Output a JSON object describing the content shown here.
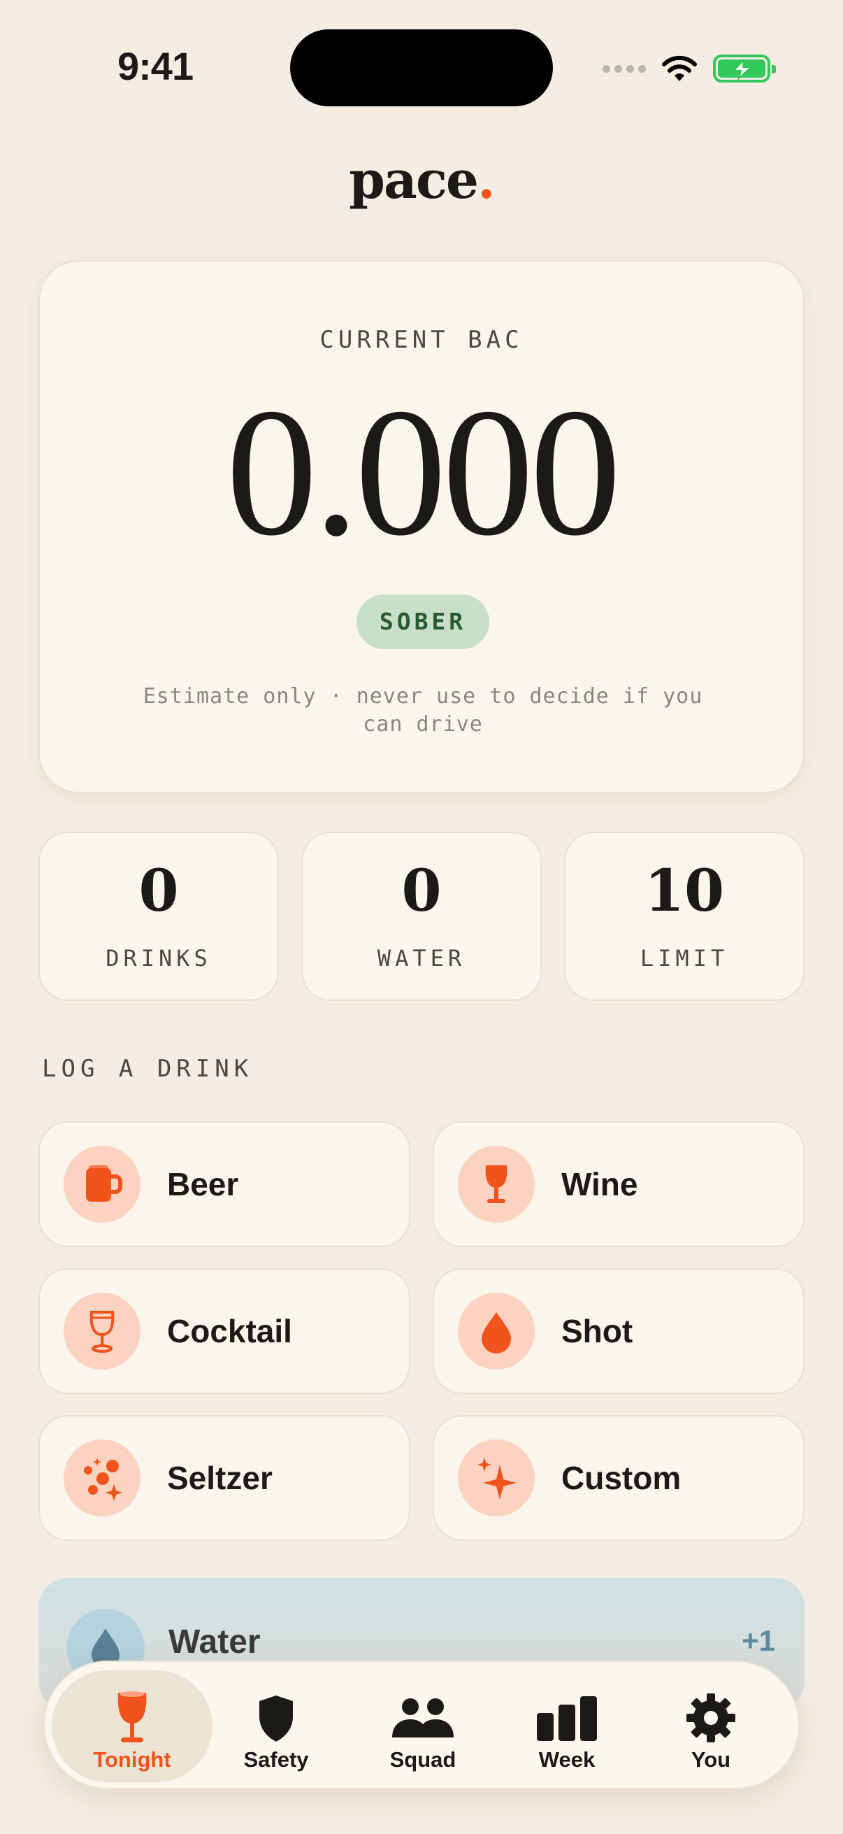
{
  "status_bar": {
    "time": "9:41"
  },
  "app": {
    "logo_text": "pace",
    "logo_dot": "."
  },
  "bac_card": {
    "label": "CURRENT BAC",
    "value": "0.000",
    "status_badge": "SOBER",
    "disclaimer": "Estimate only · never use to decide if you can drive"
  },
  "stats": [
    {
      "value": "0",
      "label": "DRINKS"
    },
    {
      "value": "0",
      "label": "WATER"
    },
    {
      "value": "10",
      "label": "LIMIT"
    }
  ],
  "log_section": {
    "title": "LOG A DRINK",
    "drinks": [
      {
        "label": "Beer",
        "icon": "mug-icon"
      },
      {
        "label": "Wine",
        "icon": "wine-glass-icon"
      },
      {
        "label": "Cocktail",
        "icon": "cocktail-glass-icon"
      },
      {
        "label": "Shot",
        "icon": "drop-icon"
      },
      {
        "label": "Seltzer",
        "icon": "bubbles-icon"
      },
      {
        "label": "Custom",
        "icon": "sparkle-icon"
      }
    ]
  },
  "water_button": {
    "label": "Water",
    "action": "+1",
    "icon": "water-drop-icon"
  },
  "tab_bar": {
    "tabs": [
      {
        "label": "Tonight",
        "icon": "glass-icon",
        "active": true
      },
      {
        "label": "Safety",
        "icon": "shield-icon",
        "active": false
      },
      {
        "label": "Squad",
        "icon": "people-icon",
        "active": false
      },
      {
        "label": "Week",
        "icon": "bar-chart-icon",
        "active": false
      },
      {
        "label": "You",
        "icon": "gear-icon",
        "active": false
      }
    ]
  },
  "colors": {
    "background": "#f3ede3",
    "accent": "#f0531c",
    "card": "#faf6ee",
    "sober_badge": "#c9dfc7",
    "icon_bg": "#fbd3c0"
  }
}
